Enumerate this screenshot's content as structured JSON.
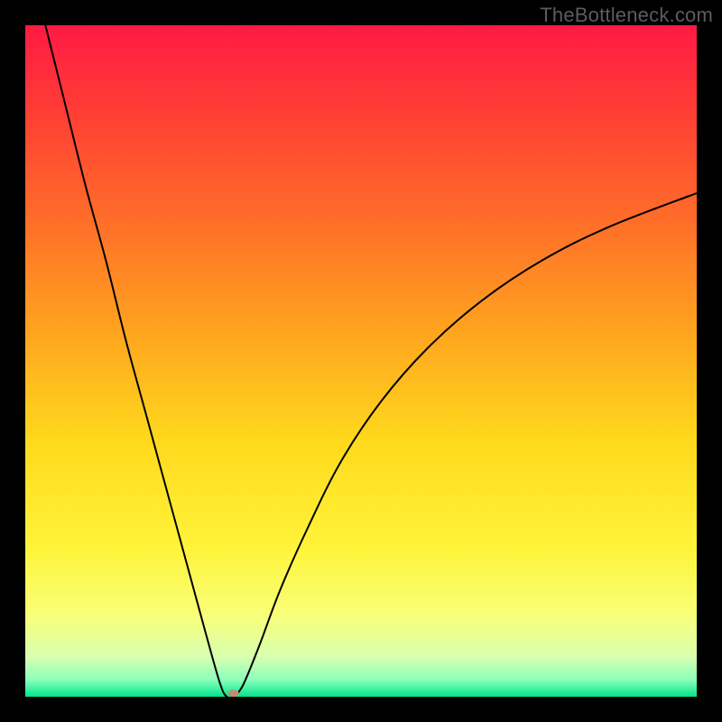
{
  "watermark": "TheBottleneck.com",
  "chart_data": {
    "type": "line",
    "title": "",
    "xlabel": "",
    "ylabel": "",
    "xlim": [
      0,
      100
    ],
    "ylim": [
      0,
      100
    ],
    "grid": false,
    "legend": false,
    "gradient_stops": [
      {
        "offset": 0.0,
        "color": "#ff1a44"
      },
      {
        "offset": 0.12,
        "color": "#ff3b36"
      },
      {
        "offset": 0.28,
        "color": "#ff6a2a"
      },
      {
        "offset": 0.45,
        "color": "#ffa21f"
      },
      {
        "offset": 0.62,
        "color": "#ffd91c"
      },
      {
        "offset": 0.78,
        "color": "#fff43a"
      },
      {
        "offset": 0.88,
        "color": "#f8ff7a"
      },
      {
        "offset": 0.94,
        "color": "#d8ffb0"
      },
      {
        "offset": 0.975,
        "color": "#8affba"
      },
      {
        "offset": 1.0,
        "color": "#00e58a"
      }
    ],
    "series": [
      {
        "name": "bottleneck-curve",
        "color": "#000000",
        "stroke_width": 2,
        "x": [
          3,
          6,
          9,
          12,
          15,
          18,
          21,
          24,
          27,
          29,
          30,
          31,
          32,
          33,
          35,
          38,
          42,
          47,
          53,
          60,
          68,
          77,
          87,
          100
        ],
        "y": [
          100,
          88,
          76,
          65,
          53,
          42,
          31,
          20,
          9,
          2,
          0,
          0,
          1,
          3,
          8,
          16,
          25,
          35,
          44,
          52,
          59,
          65,
          70,
          75
        ]
      }
    ],
    "marker": {
      "name": "optimal-point",
      "x": 31,
      "y": 0.5,
      "rx": 6,
      "ry": 4,
      "color": "#c68a76"
    }
  }
}
